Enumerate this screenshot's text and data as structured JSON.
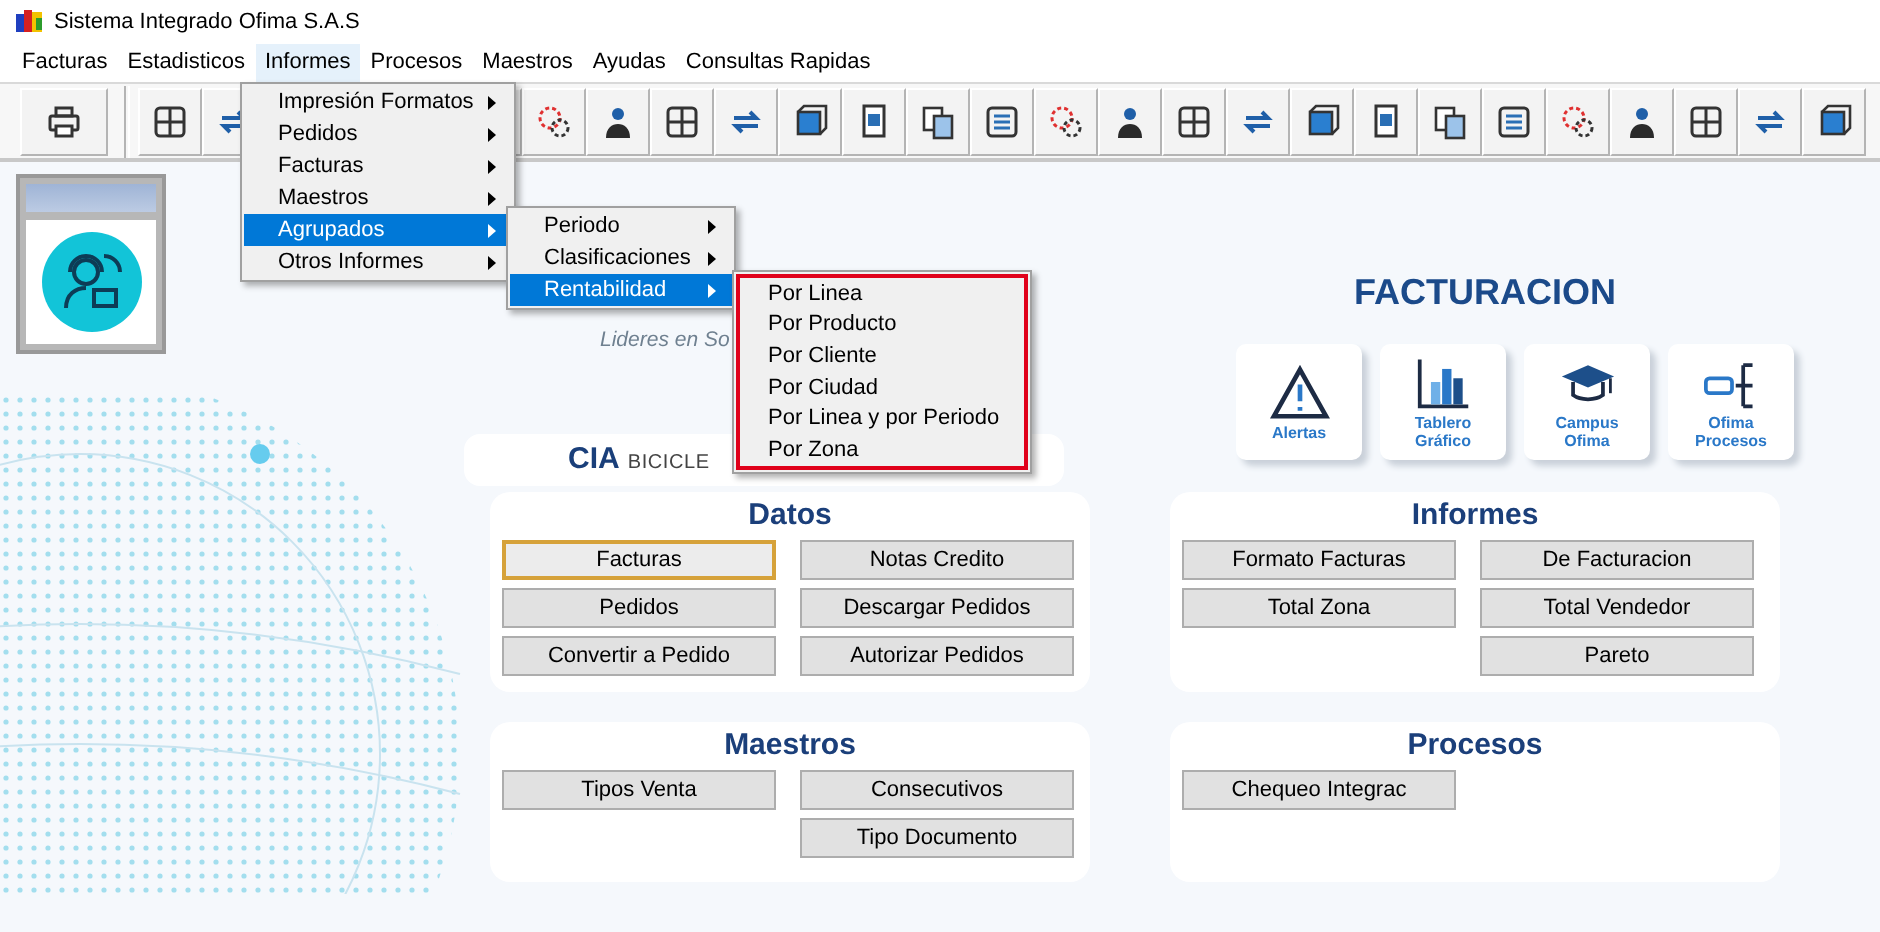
{
  "window": {
    "title": "Sistema Integrado Ofima S.A.S"
  },
  "menu_bar": [
    {
      "label": "Facturas",
      "selected": false
    },
    {
      "label": "Estadisticos",
      "selected": false
    },
    {
      "label": "Informes",
      "selected": true
    },
    {
      "label": "Procesos",
      "selected": false
    },
    {
      "label": "Maestros",
      "selected": false
    },
    {
      "label": "Ayudas",
      "selected": false
    },
    {
      "label": "Consultas Rapidas",
      "selected": false
    }
  ],
  "informes_menu": [
    {
      "label": "Impresión Formatos",
      "selected": false,
      "submenu": true
    },
    {
      "label": "Pedidos",
      "selected": false,
      "submenu": true
    },
    {
      "label": "Facturas",
      "selected": false,
      "submenu": true
    },
    {
      "label": "Maestros",
      "selected": false,
      "submenu": true
    },
    {
      "label": "Agrupados",
      "selected": true,
      "submenu": true
    },
    {
      "label": "Otros Informes",
      "selected": false,
      "submenu": true
    }
  ],
  "agrupados_menu": [
    {
      "label": "Periodo",
      "selected": false,
      "submenu": true
    },
    {
      "label": "Clasificaciones",
      "selected": false,
      "submenu": true
    },
    {
      "label": "Rentabilidad",
      "selected": true,
      "submenu": true
    }
  ],
  "rentabilidad_menu": {
    "outlined": true,
    "items": [
      "Por Linea",
      "Por Producto",
      "Por Cliente",
      "Por Ciudad",
      "Por Linea y por Periodo",
      "Por Zona"
    ]
  },
  "logo": {
    "tagline": "Lideres en So"
  },
  "company": {
    "prefix": "CIA",
    "name": "BICICLE"
  },
  "facturacion": {
    "title": "FACTURACION",
    "tiles": [
      {
        "kind": "alert",
        "label": "Alertas"
      },
      {
        "kind": "chart",
        "label": "Tablero Gráfico"
      },
      {
        "kind": "campus",
        "label": "Campus Ofima"
      },
      {
        "kind": "process",
        "label": "Ofima Procesos"
      }
    ]
  },
  "panels": [
    {
      "title": "Datos",
      "rows": [
        {
          "left": {
            "label": "Facturas",
            "selected": true
          },
          "right": {
            "label": "Notas Credito",
            "selected": false
          }
        },
        {
          "left": {
            "label": "Pedidos",
            "selected": false
          },
          "right": {
            "label": "Descargar Pedidos",
            "selected": false
          }
        },
        {
          "left": {
            "label": "Convertir a Pedido",
            "selected": false
          },
          "right": {
            "label": "Autorizar Pedidos",
            "selected": false
          }
        }
      ]
    },
    {
      "title": "Informes",
      "rows": [
        {
          "left": {
            "label": "Formato Facturas",
            "selected": false
          },
          "right": {
            "label": "De Facturacion",
            "selected": false
          }
        },
        {
          "left": {
            "label": "Total Zona",
            "selected": false
          },
          "right": {
            "label": "Total Vendedor",
            "selected": false
          }
        },
        {
          "right": {
            "label": "Pareto",
            "selected": false
          }
        }
      ]
    },
    {
      "title": "Maestros",
      "rows": [
        {
          "left": {
            "label": "Tipos Venta",
            "selected": false
          },
          "right": {
            "label": "Consecutivos",
            "selected": false
          }
        },
        {
          "right": {
            "label": "Tipo Documento",
            "selected": false
          }
        }
      ]
    },
    {
      "title": "Procesos",
      "rows": [
        {
          "left": {
            "label": "Chequeo Integrac",
            "selected": false
          }
        }
      ]
    }
  ]
}
